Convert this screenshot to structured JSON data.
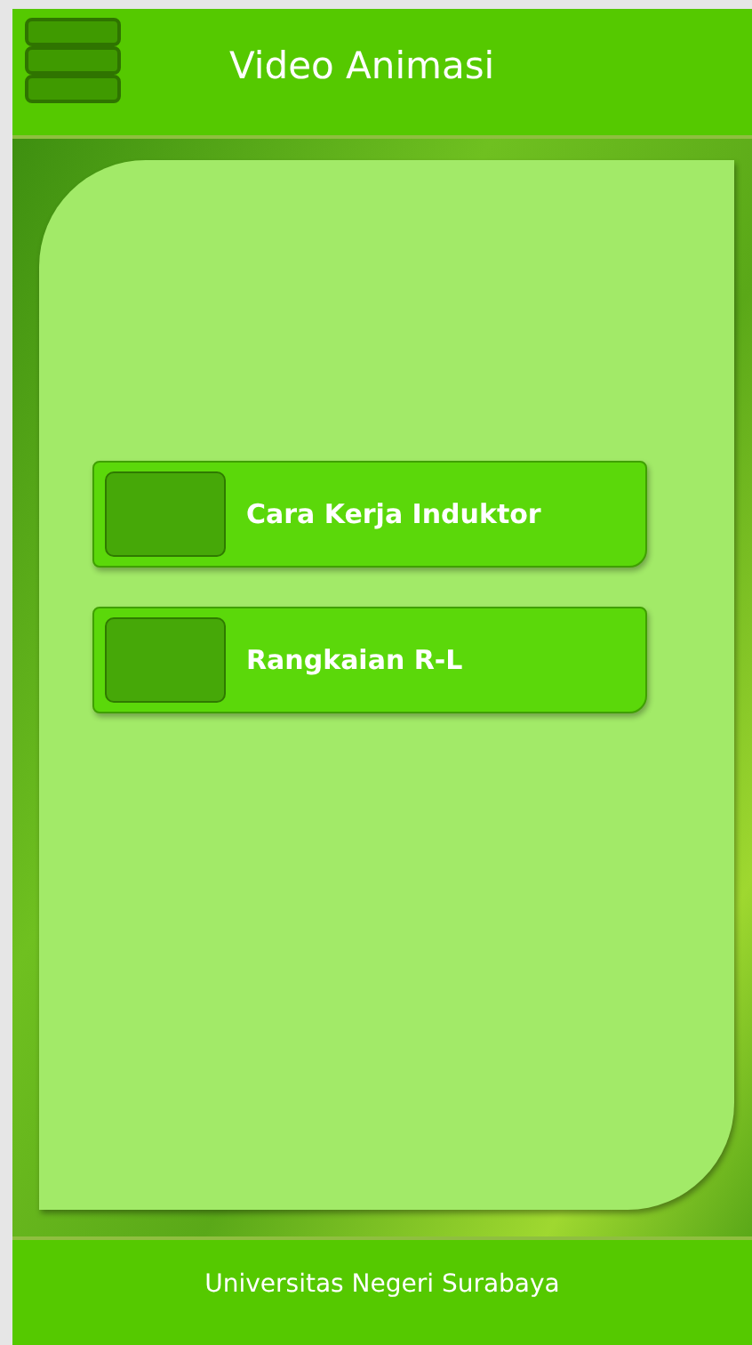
{
  "header": {
    "title": "Video Animasi"
  },
  "menu_buttons": [
    {
      "label": "Cara Kerja Induktor"
    },
    {
      "label": "Rangkaian R-L"
    }
  ],
  "footer": {
    "text": "Universitas Negeri Surabaya"
  }
}
